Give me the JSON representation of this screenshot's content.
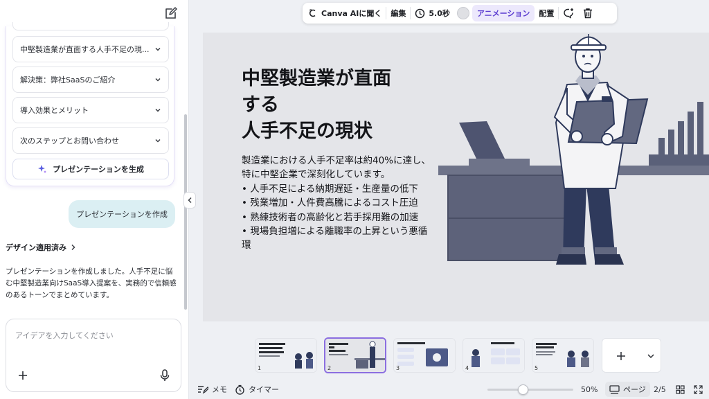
{
  "sidebar": {
    "outline_items": [
      {
        "label": "中堅製造業が直面する人手不足の現..."
      },
      {
        "label": "解決策：弊社SaaSのご紹介"
      },
      {
        "label": "導入効果とメリット"
      },
      {
        "label": "次のステップとお問い合わせ"
      }
    ],
    "generate_button": "プレゼンテーションを生成",
    "user_message": "プレゼンテーションを作成",
    "design_applied": "デザイン適用済み",
    "ai_message": "プレゼンテーションを作成しました。人手不足に悩む中堅製造業向けSaaS導入提案を、実務的で信頼感のあるトーンでまとめています。",
    "input_placeholder": "アイデアを入力してください"
  },
  "toolbar": {
    "canva_ai": "Canva AIに聞く",
    "edit": "編集",
    "duration": "5.0秒",
    "animation": "アニメーション",
    "arrange": "配置"
  },
  "slide": {
    "title": "中堅製造業が直面\nする\n人手不足の現状",
    "body": "製造業における人手不足率は約40%に達し、特に中堅企業で深刻化しています。\n• 人手不足による納期遅延・生産量の低下\n• 残業増加・人件費高騰によるコスト圧迫\n• 熟練技術者の高齢化と若手採用難の加速\n• 現場負担増による離職率の上昇という悪循環"
  },
  "thumbnails": [
    {
      "num": "1",
      "selected": false
    },
    {
      "num": "2",
      "selected": true
    },
    {
      "num": "3",
      "selected": false
    },
    {
      "num": "4",
      "selected": false
    },
    {
      "num": "5",
      "selected": false
    }
  ],
  "bottom_bar": {
    "notes": "メモ",
    "timer": "タイマー",
    "zoom": "50%",
    "page_view": "ページ",
    "page_count": "2/5"
  },
  "colors": {
    "accent": "#8b6ee0",
    "animation_bg": "#ece8fc",
    "user_bubble": "#dbeff3",
    "slide_bg": "#e4e5e9",
    "illustration_navy": "#2f3a5c"
  }
}
